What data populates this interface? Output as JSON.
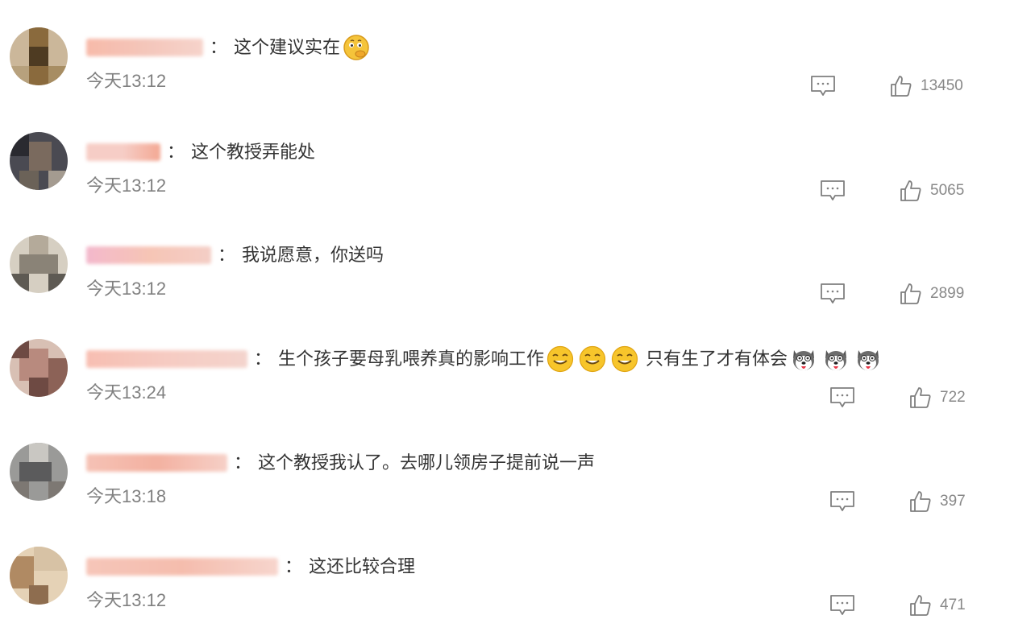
{
  "comments": [
    {
      "avatar_colors": [
        "#cbb79a",
        "#8a6a3d",
        "#4e3b22",
        "#a78d63"
      ],
      "name_blur_colors": [
        "#f7b3a1",
        "#f3c0b3",
        "#f6cfc6"
      ],
      "text_parts": [
        "这个建议实在"
      ],
      "emoji_names": [
        "thinking-emoji"
      ],
      "time": "今天13:12",
      "likes": "13450"
    },
    {
      "avatar_colors": [
        "#4a4a52",
        "#7a6a5e",
        "#2a2a30",
        "#a49b90"
      ],
      "name_blur_colors": [
        "#f6c8c0",
        "#f29f88"
      ],
      "text_parts": [
        "这个教授弄能处"
      ],
      "emoji_names": [],
      "time": "今天13:12",
      "likes": "5065"
    },
    {
      "avatar_colors": [
        "#d6cfc2",
        "#8a8377",
        "#5e5a53",
        "#b4aa9a"
      ],
      "name_blur_colors": [
        "#f2b1c7",
        "#f6bfae",
        "#f3c9c0"
      ],
      "text_parts": [
        "我说愿意，你送吗"
      ],
      "emoji_names": [],
      "time": "今天13:12",
      "likes": "2899"
    },
    {
      "avatar_colors": [
        "#b88a7e",
        "#6e4a43",
        "#d8c0b4",
        "#8c6257"
      ],
      "name_blur_colors": [
        "#f7b8aa",
        "#f6c6bc",
        "#f3d0c8"
      ],
      "text_parts": [
        "生个孩子要母乳喂养真的影响工作",
        "只有生了才有体会"
      ],
      "emoji_names": [
        "smile-emoji",
        "smile-emoji",
        "smile-emoji",
        "husky-emoji",
        "husky-emoji",
        "husky-emoji"
      ],
      "time": "今天13:24",
      "likes": "722"
    },
    {
      "avatar_colors": [
        "#9a9a98",
        "#5b5b5c",
        "#c9c7c2",
        "#7d7873"
      ],
      "name_blur_colors": [
        "#f5bcae",
        "#f2a997",
        "#f6cbc1"
      ],
      "text_parts": [
        "这个教授我认了。去哪儿领房子提前说一声"
      ],
      "emoji_names": [],
      "time": "今天13:18",
      "likes": "397"
    },
    {
      "avatar_colors": [
        "#e5d2b6",
        "#b08a63",
        "#d7c2a5",
        "#8e6d4f"
      ],
      "name_blur_colors": [
        "#f6c0b2",
        "#f4b6a5",
        "#f7d1c8"
      ],
      "text_parts": [
        "这还比较合理"
      ],
      "emoji_names": [],
      "time": "今天13:12",
      "likes": "471"
    }
  ],
  "colors": {
    "text": "#333333",
    "muted": "#808080",
    "icon": "#7f7f7f",
    "smile_emoji": "#f7c52b",
    "thinking_emoji": "#f5c43a"
  }
}
